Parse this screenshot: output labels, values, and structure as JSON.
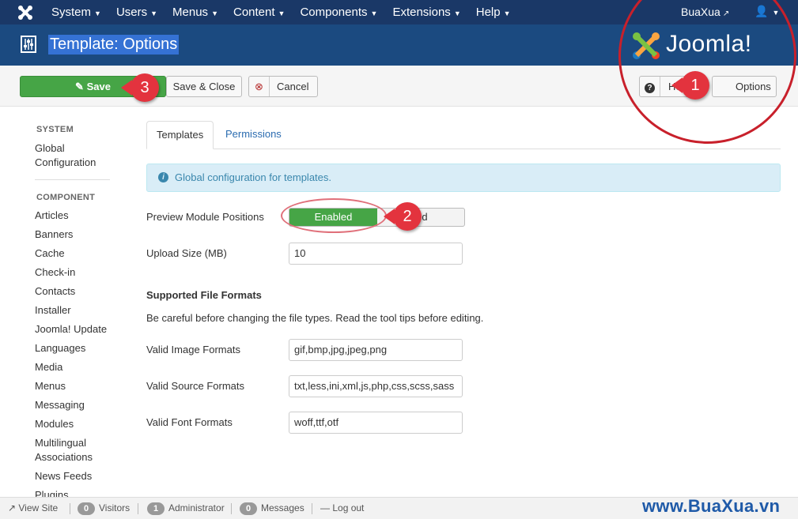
{
  "topnav": {
    "menu": [
      "System",
      "Users",
      "Menus",
      "Content",
      "Components",
      "Extensions",
      "Help"
    ],
    "user": "BuaXua"
  },
  "header": {
    "title": "Template: Options",
    "brand": "Joomla!"
  },
  "toolbar": {
    "save": "Save",
    "save_close": "Save & Close",
    "cancel": "Cancel",
    "help": "Help",
    "options": "Options"
  },
  "sidebar": {
    "system_heading": "SYSTEM",
    "system_items": [
      "Global",
      "Configuration"
    ],
    "component_heading": "COMPONENT",
    "items": [
      "Articles",
      "Banners",
      "Cache",
      "Check-in",
      "Contacts",
      "Installer",
      "Joomla! Update",
      "Languages",
      "Media",
      "Menus",
      "Messaging",
      "Modules",
      "Multilingual",
      "Associations",
      "News Feeds",
      "Plugins"
    ]
  },
  "tabs": [
    "Templates",
    "Permissions"
  ],
  "alert": "Global configuration for templates.",
  "form": {
    "preview_label": "Preview Module Positions",
    "toggle_on": "Enabled",
    "toggle_off": "led",
    "upload_label": "Upload Size (MB)",
    "upload_value": "10",
    "section_title": "Supported File Formats",
    "section_desc": "Be careful before changing the file types. Read the tool tips before editing.",
    "image_label": "Valid Image Formats",
    "image_value": "gif,bmp,jpg,jpeg,png",
    "source_label": "Valid Source Formats",
    "source_value": "txt,less,ini,xml,js,php,css,scss,sass",
    "font_label": "Valid Font Formats",
    "font_value": "woff,ttf,otf"
  },
  "statusbar": {
    "view_site": "View Site",
    "visitors_count": "0",
    "visitors": "Visitors",
    "admin_count": "1",
    "admin": "Administrator",
    "messages_count": "0",
    "messages": "Messages",
    "logout": "Log out"
  },
  "watermark": "www.BuaXua.vn",
  "annotations": [
    "1",
    "2",
    "3"
  ],
  "colors": {
    "nav": "#1a3867",
    "header": "#1b4a80",
    "save": "#46a546",
    "pin": "#e3333e"
  }
}
